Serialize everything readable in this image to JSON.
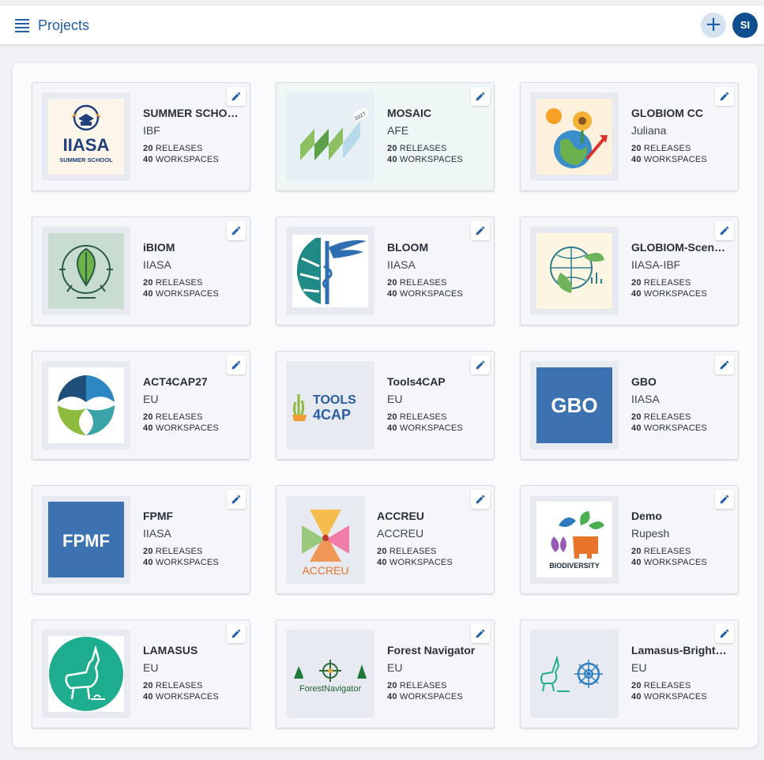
{
  "header": {
    "title": "Projects",
    "add_label": "+",
    "avatar_initials": "SI"
  },
  "projects": [
    {
      "name": "SUMMER SCHOOL",
      "org": "IBF",
      "releases": "20",
      "workspaces": "40",
      "logo_text": "IIASA",
      "logo_sub": "SUMMER SCHOOL"
    },
    {
      "name": "MOSAIC",
      "org": "AFE",
      "releases": "20",
      "workspaces": "40",
      "logo_text": "2027"
    },
    {
      "name": "GLOBIOM CC",
      "org": "Juliana",
      "releases": "20",
      "workspaces": "40"
    },
    {
      "name": "iBIOM",
      "org": "IIASA",
      "releases": "20",
      "workspaces": "40"
    },
    {
      "name": "BLOOM",
      "org": "IIASA",
      "releases": "20",
      "workspaces": "40"
    },
    {
      "name": "GLOBIOM-Scena…",
      "org": "IIASA-IBF",
      "releases": "20",
      "workspaces": "40"
    },
    {
      "name": "ACT4CAP27",
      "org": "EU",
      "releases": "20",
      "workspaces": "40"
    },
    {
      "name": "Tools4CAP",
      "org": "EU",
      "releases": "20",
      "workspaces": "40",
      "logo_text": "TOOLS",
      "logo_sub": "4CAP"
    },
    {
      "name": "GBO",
      "org": "IIASA",
      "releases": "20",
      "workspaces": "40",
      "logo_text": "GBO"
    },
    {
      "name": "FPMF",
      "org": "IIASA",
      "releases": "20",
      "workspaces": "40",
      "logo_text": "FPMF"
    },
    {
      "name": "ACCREU",
      "org": "ACCREU",
      "releases": "20",
      "workspaces": "40",
      "logo_text": "ACCREU"
    },
    {
      "name": "Demo",
      "org": "Rupesh",
      "releases": "20",
      "workspaces": "40",
      "logo_text": "BIODIVERSITY"
    },
    {
      "name": "LAMASUS",
      "org": "EU",
      "releases": "20",
      "workspaces": "40"
    },
    {
      "name": "Forest Navigator",
      "org": "EU",
      "releases": "20",
      "workspaces": "40",
      "logo_text": "ForestNavigator"
    },
    {
      "name": "Lamasus-Brights…",
      "org": "EU",
      "releases": "20",
      "workspaces": "40"
    }
  ],
  "labels": {
    "releases": "RELEASES",
    "workspaces": "WORKSPACES"
  },
  "icons": {
    "menu": "menu-icon",
    "edit": "pencil-icon",
    "add": "plus-icon"
  },
  "colors": {
    "accent": "#1f5fa8",
    "avatar": "#0f4f8f",
    "gbo_bg": "#3d72b0",
    "fpmf_bg": "#3d72b0"
  }
}
